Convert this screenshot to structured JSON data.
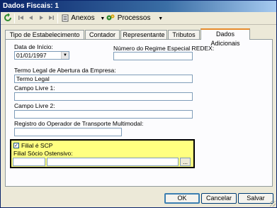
{
  "window": {
    "title": "Dados Fiscais: 1"
  },
  "toolbar": {
    "anexos_label": "Anexos",
    "processos_label": "Processos"
  },
  "tabs": [
    {
      "label": "Tipo de Estabelecimento"
    },
    {
      "label": "Contador"
    },
    {
      "label": "Representante"
    },
    {
      "label": "Tributos"
    },
    {
      "label": "Dados Adicionais"
    }
  ],
  "form": {
    "data_inicio_label": "Data de Início:",
    "data_inicio_value": "01/01/1997",
    "redex_label": "Número do Regime Especial REDEX:",
    "redex_value": "",
    "termo_label": "Termo Legal de Abertura da Empresa:",
    "termo_value": "Termo Legal",
    "campo1_label": "Campo Livre 1:",
    "campo1_value": "",
    "campo2_label": "Campo Livre 2:",
    "campo2_value": "",
    "registro_label": "Registro do Operador de Transporte Multimodal:",
    "registro_value": ""
  },
  "scp": {
    "checkbox_label": "Filial é SCP",
    "checked": true,
    "socio_label": "Filial Sócio Ostensivo:",
    "socio_code": "",
    "socio_name": "",
    "browse_label": "..."
  },
  "buttons": {
    "ok": "OK",
    "cancel": "Cancelar",
    "save": "Salvar"
  }
}
